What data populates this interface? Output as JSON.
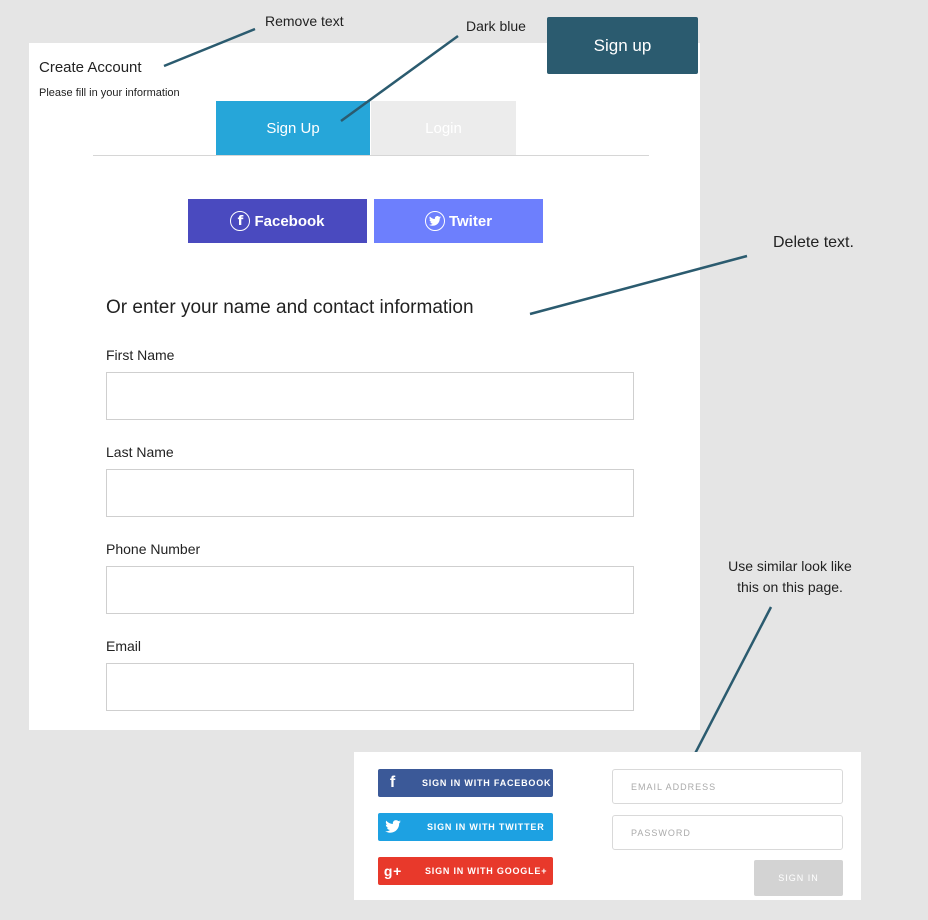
{
  "form": {
    "title": "Create Account",
    "subtitle": "Please fill in your information",
    "tabs": {
      "signup": "Sign Up",
      "login": "Login"
    },
    "social": {
      "facebook": {
        "label": "Facebook",
        "icon": "facebook-icon",
        "color": "#4a4abf"
      },
      "twitter": {
        "label": "Twiter",
        "icon": "twitter-icon",
        "color": "#6d7ffd"
      }
    },
    "heading": "Or enter your name and contact information",
    "fields": {
      "first_name": "First Name",
      "last_name": "Last Name",
      "phone": "Phone Number",
      "email": "Email"
    },
    "accent_color": "#26a6d9"
  },
  "signup_button": {
    "label": "Sign up",
    "color": "#2b5b6f"
  },
  "annotations": {
    "remove_text": "Remove text",
    "dark_blue": "Dark blue",
    "delete_text": "Delete text.",
    "similar_look_line1": "Use similar look like",
    "similar_look_line2": "this on this page."
  },
  "sample": {
    "facebook_btn": "SIGN IN WITH FACEBOOK",
    "twitter_btn": "SIGN IN WITH TWITTER",
    "google_btn": "SIGN IN WITH GOOGLE+",
    "email_placeholder": "EMAIL ADDRESS",
    "password_placeholder": "PASSWORD",
    "signin_btn": "SIGN IN",
    "fb_glyph": "f",
    "gp_glyph": "g+"
  }
}
